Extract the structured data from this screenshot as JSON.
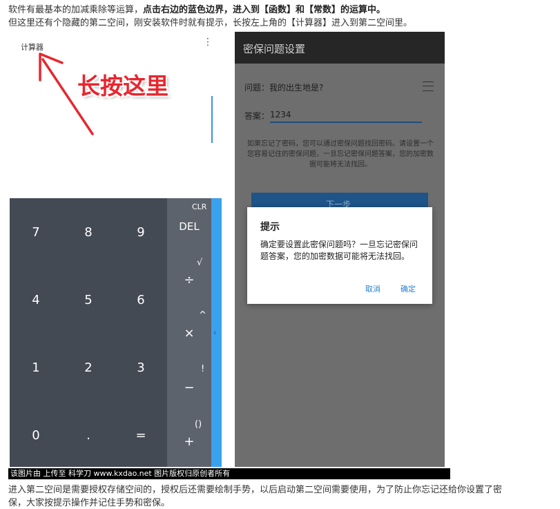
{
  "intro": {
    "line1_plain": "软件有最基本的加减乘除等运算，",
    "line1_bold": "点击右边的蓝色边界，进入到【函数】和【常数】的运算中。",
    "line2": "但这里还有个隐藏的第二空间，刚安装软件时就有提示，长按左上角的【计算器】进入到第二空间里。"
  },
  "calculator": {
    "app_name": "计算器",
    "menu_icon": "⋮",
    "annotation": "长按这里",
    "digits": [
      "7",
      "8",
      "9",
      "4",
      "5",
      "6",
      "1",
      "2",
      "3",
      "0",
      ".",
      "="
    ],
    "ops": {
      "clr": "CLR",
      "del": "DEL",
      "sqrt": "√",
      "div": "÷",
      "pow": "^",
      "mul": "×",
      "fact": "!",
      "sub": "−",
      "paren": "()",
      "add": "+"
    },
    "edge_chevron": "‹",
    "colors": {
      "pad": "#444a54",
      "ops": "#5d636c",
      "edge": "#3aa1ef"
    }
  },
  "security": {
    "title": "密保问题设置",
    "question": "问题：我的出生地是?",
    "answer_label": "答案：",
    "answer_value": "1234",
    "hint": "如果忘记了密码，您可以通过密保问题找回密码。请设置一个您容易记住的密保问题，一旦忘记密保问题答案，您的加密数据可能将无法找回。",
    "next_button": "下一步",
    "dialog": {
      "title": "提示",
      "message": "确定要设置此密保问题吗？一旦忘记密保问题答案，您的加密数据可能将无法找回。",
      "cancel": "取消",
      "confirm": "确定"
    }
  },
  "caption": "该图片由  上传至  科学刀  www.kxdao.net  图片版权归原创者所有",
  "outro": {
    "line1": "进入第二空间是需要授权存储空间的，授权后还需要绘制手势，以后启动第二空间需要使用，为了防止你忘记还给你设置了密",
    "line2": "保，大家按提示操作并记住手势和密保。"
  }
}
